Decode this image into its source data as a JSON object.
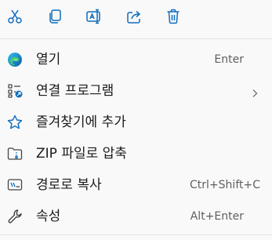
{
  "toolbar": {
    "buttons": [
      {
        "icon": "scissors-icon",
        "action": "cut"
      },
      {
        "icon": "copy-icon",
        "action": "copy"
      },
      {
        "icon": "rename-icon",
        "action": "rename"
      },
      {
        "icon": "share-icon",
        "action": "share"
      },
      {
        "icon": "trash-icon",
        "action": "delete"
      }
    ]
  },
  "menu": {
    "items": [
      {
        "label": "열기",
        "shortcut": "Enter",
        "icon": "edge-browser-icon"
      },
      {
        "label": "연결 프로그램",
        "shortcut": "",
        "icon": "open-with-icon",
        "submenu": true
      },
      {
        "label": "즐겨찾기에 추가",
        "shortcut": "",
        "icon": "star-icon"
      },
      {
        "label": "ZIP 파일로 압축",
        "shortcut": "",
        "icon": "zip-folder-icon"
      },
      {
        "label": "경로로 복사",
        "shortcut": "Ctrl+Shift+C",
        "icon": "copy-path-icon"
      },
      {
        "label": "속성",
        "shortcut": "Alt+Enter",
        "icon": "wrench-icon"
      }
    ]
  },
  "colors": {
    "icon_blue": "#0f6cbd",
    "text": "#1b1b1b",
    "shortcut_text": "#5f5f5f",
    "background": "#f9f9f9",
    "divider": "#e3e3e3"
  }
}
